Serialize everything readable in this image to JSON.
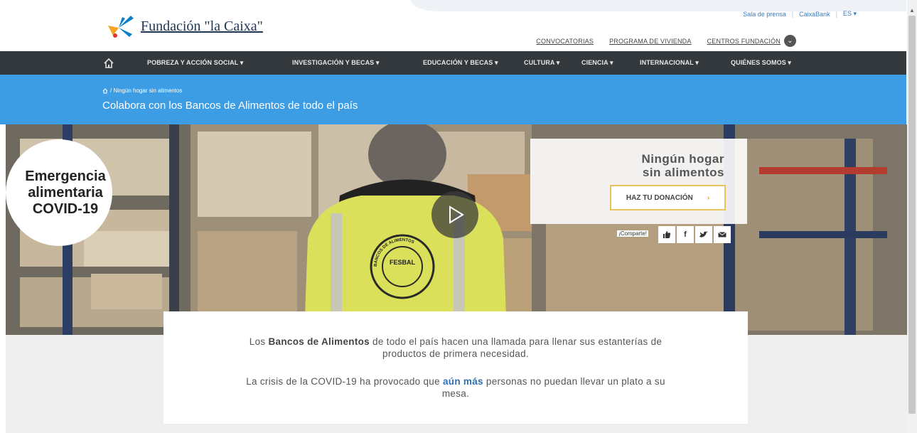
{
  "header": {
    "logo_text": "Fundación \"la Caixa\"",
    "utility_links": [
      "Sala de prensa",
      "CaixaBank",
      "ES ▾"
    ],
    "secondary_nav": {
      "convocatorias": "CONVOCATORIAS",
      "programa_vivienda": "PROGRAMA DE VIVIENDA",
      "centros": "CENTROS FUNDACIÓN"
    }
  },
  "main_nav": {
    "items": [
      "POBREZA Y ACCIÓN SOCIAL ▾",
      "INVESTIGACIÓN Y BECAS ▾",
      "EDUCACIÓN Y BECAS ▾",
      "CULTURA ▾",
      "CIENCIA ▾",
      "INTERNACIONAL ▾",
      "QUIÉNES SOMOS ▾"
    ]
  },
  "banner": {
    "breadcrumb": "/ Ningún hogar sin alimentos",
    "title": "Colabora con los Bancos de Alimentos de todo el país"
  },
  "hero": {
    "emergency_text": "Emergencia\nalimentaria\nCOVID-19",
    "donation_title": "Ningún hogar\nsin alimentos",
    "donate_button": "HAZ TU DONACIÓN",
    "share_label": "¡Comparte!",
    "share_icons": [
      "thumbs-up-icon",
      "facebook-icon",
      "twitter-icon",
      "email-icon"
    ],
    "vest_logo_text": "FESBAL",
    "vest_ring_text": "BANCOS DE ALIMENTOS"
  },
  "content": {
    "p1_pre": "Los ",
    "p1_bold": "Bancos de Alimentos",
    "p1_post": " de todo el país hacen una llamada para llenar sus estanterías de productos de primera necesidad.",
    "p2_pre": "La crisis de la COVID-19 ha provocado que ",
    "p2_bold": "aún más",
    "p2_post": " personas no puedan llevar un plato a su mesa."
  },
  "colors": {
    "nav_bg": "#33383d",
    "banner_blue": "#3d9de4",
    "donate_border": "#e8c35a",
    "highlight_blue": "#2f6fb3"
  }
}
